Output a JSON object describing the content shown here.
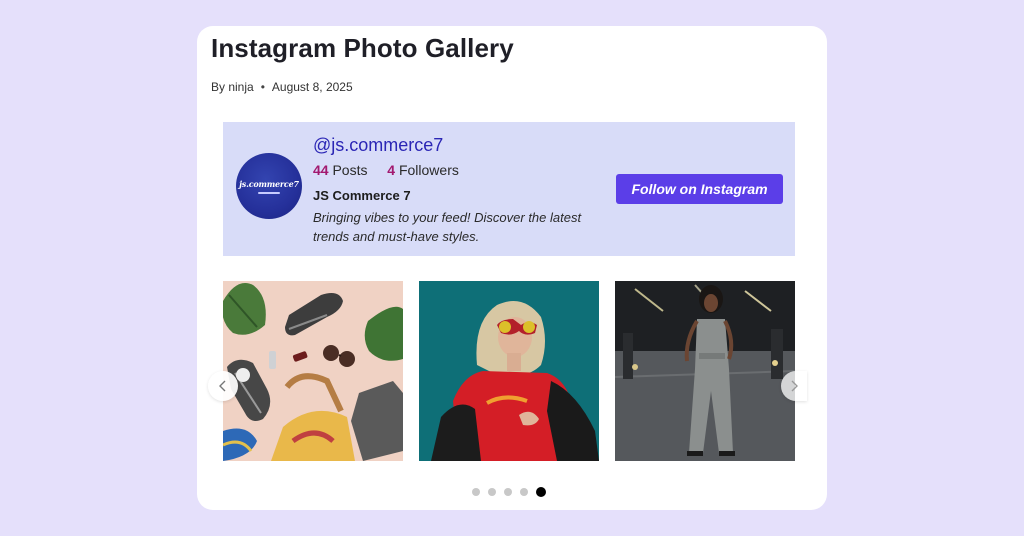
{
  "post": {
    "title": "Instagram Photo Gallery",
    "author_label": "By ninja",
    "separator": "•",
    "date": "August 8, 2025"
  },
  "profile": {
    "avatar_text": "js.commerce7",
    "username": "@js.commerce7",
    "posts_count": "44",
    "posts_label": "Posts",
    "followers_count": "4",
    "followers_label": "Followers",
    "display_name": "JS Commerce 7",
    "bio": "Bringing vibes to your feed! Discover the latest trends and must-have styles.",
    "follow_button": "Follow on Instagram"
  },
  "gallery": {
    "photos": [
      {
        "subject": "flatlay-sneakers-accessories"
      },
      {
        "subject": "woman-sunglasses-red-shirt"
      },
      {
        "subject": "woman-jumpsuit-street-night"
      }
    ],
    "prev_icon": "chevron-left-icon",
    "next_icon": "chevron-right-icon",
    "pagination": {
      "total": 5,
      "active_index": 4
    }
  },
  "colors": {
    "page_bg": "#e5e0fb",
    "header_bg": "#d8dcf8",
    "username": "#2b26b5",
    "stat_number": "#a2186f",
    "follow_button": "#5b3ee8"
  }
}
